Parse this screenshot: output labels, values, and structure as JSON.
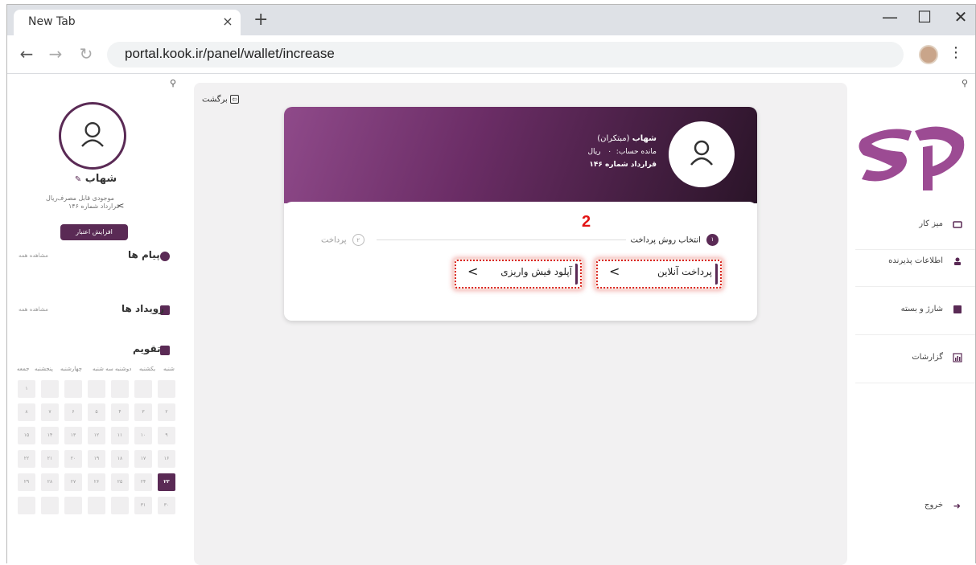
{
  "browser": {
    "tab_title": "New Tab",
    "tab_close": "×",
    "new_tab": "+",
    "window_controls": {
      "minimize": "—",
      "maximize": "☐",
      "close": "✕"
    },
    "nav": {
      "back": "←",
      "forward": "→",
      "reload": "↻"
    },
    "url": "portal.kook.ir/panel/wallet/increase",
    "menu": "⋮"
  },
  "left_sidebar": {
    "pin": "⚲",
    "user_name": "شهاب",
    "balance_label": "موجودی قابل مصرف",
    "balance_value": "۰",
    "currency": "ریال",
    "contract": "قرارداد شماره ۱۴۶",
    "contract_chevron": ">",
    "credit_button": "افزایش اعتبار",
    "messages_title": "پیام ها",
    "messages_see_all": "مشاهده همه",
    "events_title": "رویداد ها",
    "events_see_all": "مشاهده همه",
    "calendar_title": "تقویم",
    "calendar_days": [
      "شنبه",
      "یکشنبه",
      "دوشنبه",
      "سه شنبه",
      "چهارشنبه",
      "پنجشنبه",
      "جمعه"
    ],
    "calendar_rows": [
      [
        "",
        "",
        "",
        "",
        "",
        "",
        "۱"
      ],
      [
        "۲",
        "۳",
        "۴",
        "۵",
        "۶",
        "۷",
        "۸"
      ],
      [
        "۹",
        "۱۰",
        "۱۱",
        "۱۲",
        "۱۳",
        "۱۴",
        "۱۵"
      ],
      [
        "۱۶",
        "۱۷",
        "۱۸",
        "۱۹",
        "۲۰",
        "۲۱",
        "۲۲"
      ],
      [
        "۲۳",
        "۲۴",
        "۲۵",
        "۲۶",
        "۲۷",
        "۲۸",
        "۲۹"
      ],
      [
        "۳۰",
        "۳۱",
        "",
        "",
        "",
        "",
        ""
      ]
    ],
    "today": "۲۳"
  },
  "main": {
    "back_label": "برگشت",
    "header": {
      "name": "شهاب",
      "role": "(مبتکران)",
      "balance_label": "مانده حساب:",
      "balance_value": "۰",
      "currency": "ریال",
      "contract": "قرارداد شماره ۱۴۶"
    },
    "steps": [
      {
        "number": "۱",
        "label": "انتخاب روش پرداخت"
      },
      {
        "number": "۲",
        "label": "پرداخت"
      }
    ],
    "annotation": "2",
    "options": [
      {
        "label": "پرداخت آنلاین",
        "arrow": "<"
      },
      {
        "label": "آپلود فیش واریزی",
        "arrow": "<"
      }
    ]
  },
  "right_sidebar": {
    "nav": [
      {
        "label": "میز کار",
        "icon": "desk-icon"
      },
      {
        "label": "اطلاعات پذیرنده",
        "icon": "user-info-icon"
      },
      {
        "label": "شارژ و بسته",
        "icon": "charge-icon"
      },
      {
        "label": "گزارشات",
        "icon": "report-icon"
      }
    ],
    "logout": "خروج"
  },
  "colors": {
    "brand": "#5a2a55",
    "annotation": "#e31414"
  }
}
